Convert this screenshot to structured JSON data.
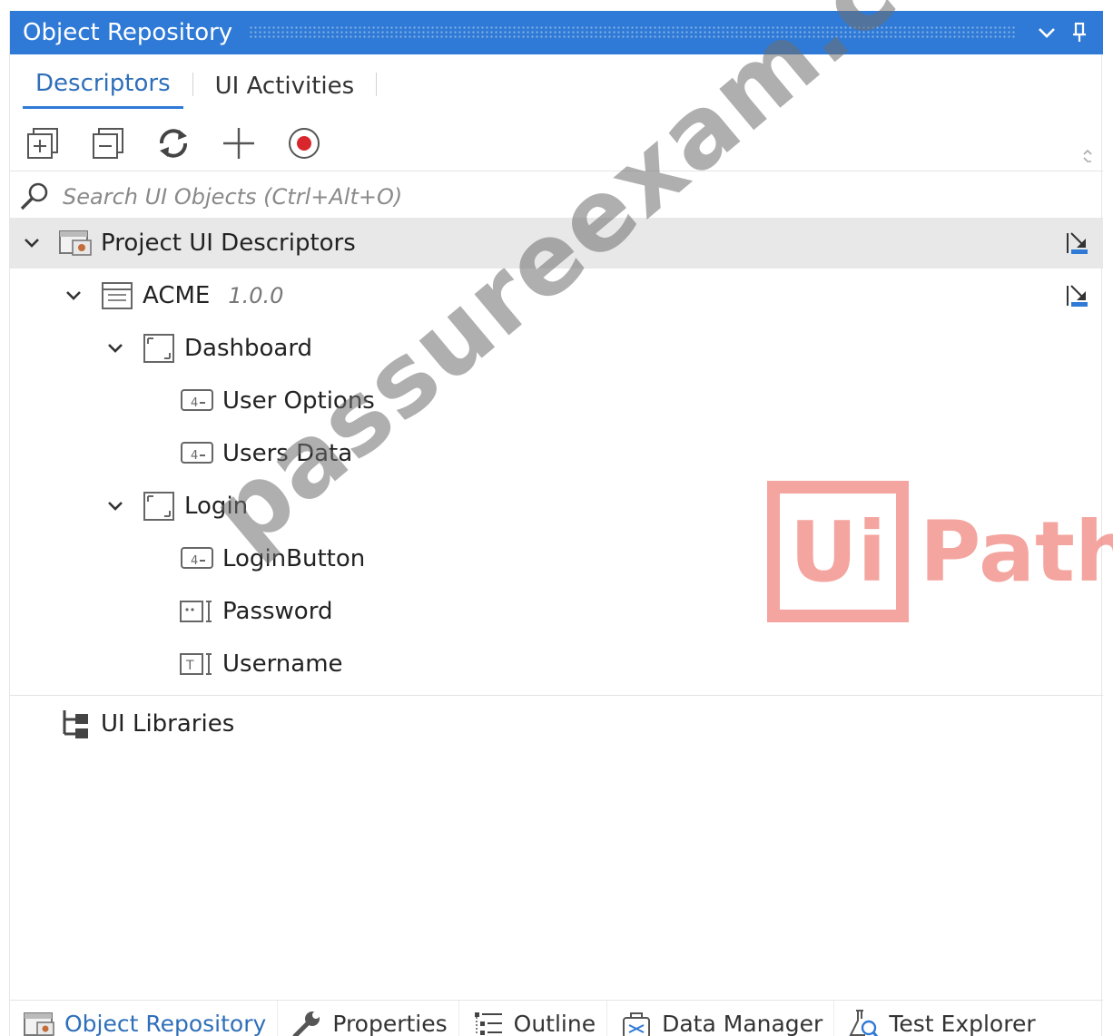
{
  "window": {
    "title": "Object Repository"
  },
  "tabs": [
    {
      "label": "Descriptors",
      "active": true
    },
    {
      "label": "UI Activities",
      "active": false
    }
  ],
  "toolbar": {
    "icons": [
      "expand-all-icon",
      "collapse-all-icon",
      "refresh-icon",
      "add-icon",
      "record-icon"
    ]
  },
  "search": {
    "placeholder": "Search UI Objects (Ctrl+Alt+O)",
    "value": ""
  },
  "tree": {
    "root": {
      "label": "Project UI Descriptors"
    },
    "app": {
      "label": "ACME",
      "version": "1.0.0"
    },
    "screens": [
      {
        "label": "Dashboard",
        "elements": [
          {
            "label": "User Options",
            "type": "button"
          },
          {
            "label": "Users Data",
            "type": "button"
          }
        ]
      },
      {
        "label": "Login",
        "elements": [
          {
            "label": "LoginButton",
            "type": "button"
          },
          {
            "label": "Password",
            "type": "password"
          },
          {
            "label": "Username",
            "type": "text"
          }
        ]
      }
    ],
    "libraries": {
      "label": "UI Libraries"
    }
  },
  "bottom_tabs": [
    {
      "label": "Object Repository",
      "icon": "object-repository-icon",
      "active": true
    },
    {
      "label": "Properties",
      "icon": "wrench-icon",
      "active": false
    },
    {
      "label": "Outline",
      "icon": "outline-icon",
      "active": false
    },
    {
      "label": "Data Manager",
      "icon": "data-manager-icon",
      "active": false
    },
    {
      "label": "Test Explorer",
      "icon": "test-explorer-icon",
      "active": false
    }
  ],
  "watermarks": {
    "text": "passureexam.com",
    "logo_box": "Ui",
    "logo_rest": "Path"
  },
  "colors": {
    "accent": "#2f7ad6",
    "selected_row": "#e8e8e8",
    "record": "#d9262c"
  }
}
